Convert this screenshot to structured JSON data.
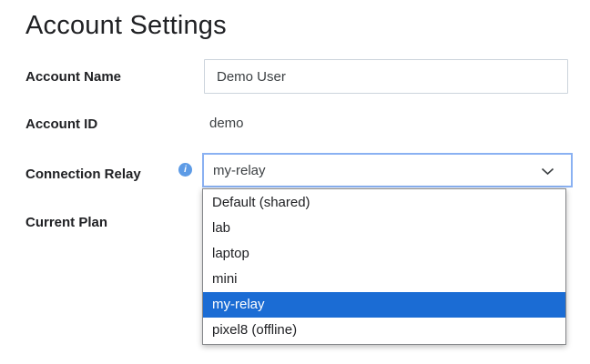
{
  "page": {
    "title": "Account Settings"
  },
  "colors": {
    "text_primary": "#202124",
    "text_secondary": "#3c4043",
    "input_border": "#ccd4dc",
    "focus_ring_blue": "#8ab1f2",
    "selection_blue": "#1b6cd4",
    "info_icon_blue": "#5d9be6",
    "dropdown_border": "#85878a"
  },
  "icons": {
    "info_glyph": "i",
    "chevron_down": "chevron-down"
  },
  "form": {
    "account_name": {
      "label": "Account Name",
      "value": "Demo User"
    },
    "account_id": {
      "label": "Account ID",
      "value": "demo"
    },
    "connection_relay": {
      "label": "Connection Relay",
      "value": "my-relay"
    },
    "current_plan": {
      "label": "Current Plan"
    },
    "relay_dropdown": {
      "options": [
        "Default (shared)",
        "lab",
        "laptop",
        "mini",
        "my-relay",
        "pixel8 (offline)"
      ],
      "selected_option": "my-relay",
      "selected_index": 4
    }
  }
}
